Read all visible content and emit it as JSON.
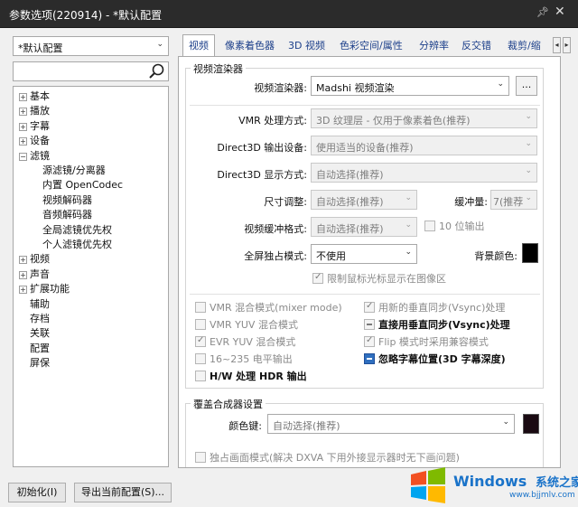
{
  "window": {
    "title": "参数选项(220914) - *默认配置"
  },
  "profile": {
    "value": "*默认配置"
  },
  "tree": [
    {
      "label": "基本",
      "expander": "+"
    },
    {
      "label": "播放",
      "expander": "+"
    },
    {
      "label": "字幕",
      "expander": "+"
    },
    {
      "label": "设备",
      "expander": "+"
    },
    {
      "label": "滤镜",
      "expander": "−"
    },
    {
      "label": "源滤镜/分离器"
    },
    {
      "label": "内置 OpenCodec"
    },
    {
      "label": "视频解码器"
    },
    {
      "label": "音频解码器"
    },
    {
      "label": "全局滤镜优先权"
    },
    {
      "label": "个人滤镜优先权"
    },
    {
      "label": "视频",
      "expander": "+"
    },
    {
      "label": "声音",
      "expander": "+"
    },
    {
      "label": "扩展功能",
      "expander": "+"
    },
    {
      "label": "辅助"
    },
    {
      "label": "存档"
    },
    {
      "label": "关联"
    },
    {
      "label": "配置"
    },
    {
      "label": "屏保"
    }
  ],
  "tabs": [
    "视频",
    "像素着色器",
    "3D 视频",
    "色彩空间/属性",
    "分辨率",
    "反交错",
    "裁剪/缩"
  ],
  "renderer_group": {
    "title": "视频渲染器",
    "renderer_label": "视频渲染器:",
    "renderer_value": "Madshi 视频渲染",
    "more_button": "...",
    "vmr_label": "VMR 处理方式:",
    "vmr_value": "3D 纹理层 - 仅用于像素着色(推荐)",
    "d3d_device_label": "Direct3D 输出设备:",
    "d3d_device_value": "使用适当的设备(推荐)",
    "d3d_display_label": "Direct3D 显示方式:",
    "d3d_display_value": "自动选择(推荐)",
    "resize_label": "尺寸调整:",
    "resize_value": "自动选择(推荐)",
    "buffer_label": "缓冲量:",
    "buffer_value": "7(推荐",
    "buf_format_label": "视频缓冲格式:",
    "buf_format_value": "自动选择(推荐)",
    "tenbit_label": "10 位输出",
    "exclusive_label": "全屏独占模式:",
    "exclusive_value": "不使用",
    "bgcolor_label": "背景颜色:",
    "bgcolor_color": "#000000",
    "limit_cursor_label": "限制鼠标光标显示在图像区"
  },
  "checks_left": [
    {
      "label": "VMR 混合模式(mixer mode)",
      "state": "unchecked"
    },
    {
      "label": "VMR YUV 混合模式",
      "state": "unchecked"
    },
    {
      "label": "EVR YUV 混合模式",
      "state": "checked"
    },
    {
      "label": "16~235 电平输出",
      "state": "unchecked"
    },
    {
      "label": "H/W 处理 HDR 输出",
      "state": "unchecked"
    }
  ],
  "checks_right": [
    {
      "label": "用新的垂直同步(Vsync)处理",
      "state": "checked"
    },
    {
      "label": "直接用垂直同步(Vsync)处理",
      "state": "partial"
    },
    {
      "label": "Flip 模式时采用兼容模式",
      "state": "checked"
    },
    {
      "label": "忽略字幕位置(3D 字幕深度)",
      "state": "focus"
    }
  ],
  "overlay_group": {
    "title": "覆盖合成器设置",
    "colorkey_label": "颜色键:",
    "colorkey_value": "自动选择(推荐)",
    "colorkey_color": "#1a0a12",
    "exclusive_screen_label": "独占画面模式(解决 DXVA 下用外接显示器时无下画问题)"
  },
  "bottom": {
    "init_button": "初始化(I)",
    "export_button": "导出当前配置(S)..."
  },
  "watermark": {
    "brand": "Windows",
    "brand_sub": "系统之家",
    "url": "www.bjjmlv.com"
  }
}
